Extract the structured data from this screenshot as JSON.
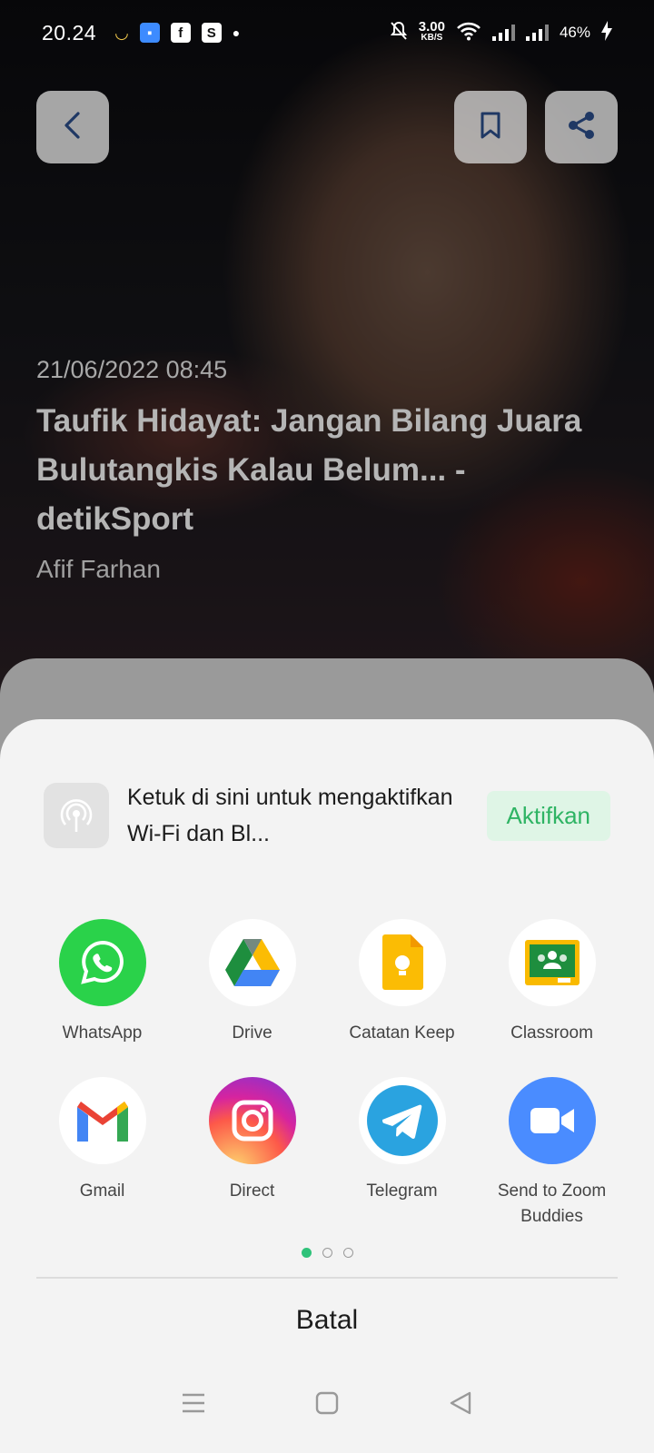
{
  "status_bar": {
    "time": "20.24",
    "speed_value": "3.00",
    "speed_unit": "KB/S",
    "battery": "46%"
  },
  "article": {
    "date": "21/06/2022 08:45",
    "headline": "Taufik Hidayat: Jangan Bilang Juara Bulutangkis Kalau Belum... - detikSport",
    "author": "Afif Farhan"
  },
  "share_sheet": {
    "nearby_text": "Ketuk di sini untuk mengaktifkan Wi-Fi dan Bl...",
    "nearby_button": "Aktifkan",
    "apps": [
      {
        "label": "WhatsApp",
        "icon": "whatsapp-icon"
      },
      {
        "label": "Drive",
        "icon": "drive-icon"
      },
      {
        "label": "Catatan Keep",
        "icon": "keep-icon"
      },
      {
        "label": "Classroom",
        "icon": "classroom-icon"
      },
      {
        "label": "Gmail",
        "icon": "gmail-icon"
      },
      {
        "label": "Direct",
        "icon": "instagram-direct-icon"
      },
      {
        "label": "Telegram",
        "icon": "telegram-icon"
      },
      {
        "label": "Send to Zoom Buddies",
        "icon": "zoom-icon"
      }
    ],
    "page_count": 3,
    "active_page": 1,
    "cancel_label": "Batal"
  },
  "colors": {
    "accent_green": "#2fb464",
    "whatsapp": "#2ad24a",
    "telegram": "#2aa3e0",
    "zoom": "#4a8cff"
  }
}
